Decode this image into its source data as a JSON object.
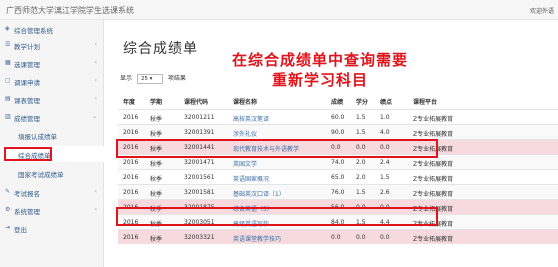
{
  "app": {
    "title": "广西师范大学漓江学院学生选课系统",
    "user": "欢迎外语"
  },
  "sidebar": {
    "items": [
      {
        "label": "综合管理系统",
        "icon": "dashboard-icon",
        "expandable": false
      },
      {
        "label": "教学计划",
        "icon": "list-icon",
        "expandable": true
      },
      {
        "label": "选课管理",
        "icon": "table-icon",
        "expandable": true
      },
      {
        "label": "调课申请",
        "icon": "file-icon",
        "expandable": true
      },
      {
        "label": "课表管理",
        "icon": "grid-icon",
        "expandable": true
      },
      {
        "label": "成绩管理",
        "icon": "chart-icon",
        "expandable": true
      }
    ],
    "sub_items": [
      {
        "label": "填报认成绩单"
      },
      {
        "label": "综合成绩单"
      },
      {
        "label": "国家考试成绩单"
      }
    ],
    "bottom_items": [
      {
        "label": "考试报名",
        "icon": "edit-icon",
        "expandable": true
      },
      {
        "label": "系统管理",
        "icon": "gear-icon",
        "expandable": true
      },
      {
        "label": "登出",
        "icon": "logout-icon",
        "expandable": false
      }
    ]
  },
  "main": {
    "page_title": "综合成绩单",
    "annotation": [
      "在综合成绩单中查询需要",
      "重新学习科目"
    ],
    "length_prefix": "显示",
    "length_value": "25",
    "length_suffix": "项结果"
  },
  "table": {
    "headers": [
      "年度",
      "学期",
      "课程代码",
      "课程名称",
      "成绩",
      "学分",
      "绩点",
      "课程平台"
    ],
    "rows": [
      [
        "2016",
        "秋季",
        "32001211",
        "高技英汉笔译",
        "60.0",
        "1.5",
        "1.0",
        "Z专业拓展教育"
      ],
      [
        "2016",
        "秋季",
        "32001391",
        "涉外礼仪",
        "90.0",
        "1.5",
        "4.0",
        "Z专业拓展教育"
      ],
      [
        "2016",
        "秋季",
        "32001441",
        "现代教育技术与外语教学",
        "0.0",
        "0.0",
        "0.0",
        "Z专业拓展教育"
      ],
      [
        "2016",
        "秋季",
        "32001471",
        "英国文学",
        "74.0",
        "2.0",
        "2.4",
        "Z专业拓展教育"
      ],
      [
        "2016",
        "秋季",
        "32001561",
        "英语国家概况",
        "65.0",
        "2.0",
        "1.5",
        "Z专业拓展教育"
      ],
      [
        "2016",
        "秋季",
        "32001581",
        "基础英汉口译（1）",
        "76.0",
        "1.5",
        "2.6",
        "Z专业拓展教育"
      ],
      [
        "2016",
        "秋季",
        "32001875",
        "综合英语（5）",
        "56.0",
        "0.0",
        "0.0",
        "Z专业拓展教育"
      ],
      [
        "2016",
        "秋季",
        "32003051",
        "高级英语写作",
        "84.0",
        "1.5",
        "4.4",
        "Z专业拓展教育"
      ],
      [
        "2016",
        "秋季",
        "32003321",
        "英语课堂教学技巧",
        "0.0",
        "0.0",
        "0.0",
        "Z专业拓展教育"
      ]
    ]
  },
  "colors": {
    "highlight": "#e0141c",
    "failed_row": "#f6dadd",
    "link": "#3a6ea8"
  }
}
